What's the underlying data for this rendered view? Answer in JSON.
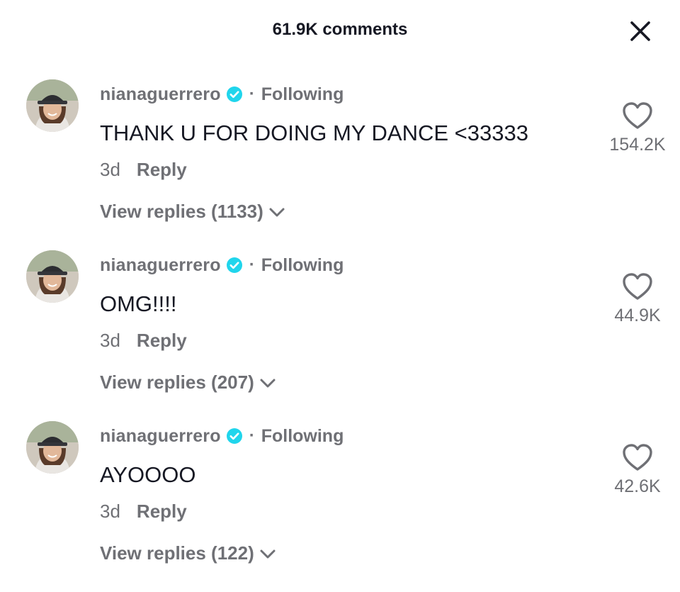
{
  "header": {
    "title": "61.9K comments",
    "close_icon": "close-icon"
  },
  "comments": [
    {
      "username": "nianaguerrero",
      "separator": "·",
      "following": "Following",
      "text": "THANK U FOR DOING MY DANCE <33333",
      "time": "3d",
      "reply_label": "Reply",
      "view_replies": "View replies (1133)",
      "likes": "154.2K"
    },
    {
      "username": "nianaguerrero",
      "separator": "·",
      "following": "Following",
      "text": "OMG!!!!",
      "time": "3d",
      "reply_label": "Reply",
      "view_replies": "View replies (207)",
      "likes": "44.9K"
    },
    {
      "username": "nianaguerrero",
      "separator": "·",
      "following": "Following",
      "text": "AYOOOO",
      "time": "3d",
      "reply_label": "Reply",
      "view_replies": "View replies (122)",
      "likes": "42.6K"
    }
  ],
  "colors": {
    "primary_text": "#161823",
    "secondary_text": "#6f7075",
    "verified_badge": "#20d5ec",
    "background": "#ffffff"
  },
  "icons": {
    "verified": "verified-badge-icon",
    "heart": "heart-outline-icon",
    "chevron": "chevron-down-icon",
    "close": "close-icon"
  }
}
